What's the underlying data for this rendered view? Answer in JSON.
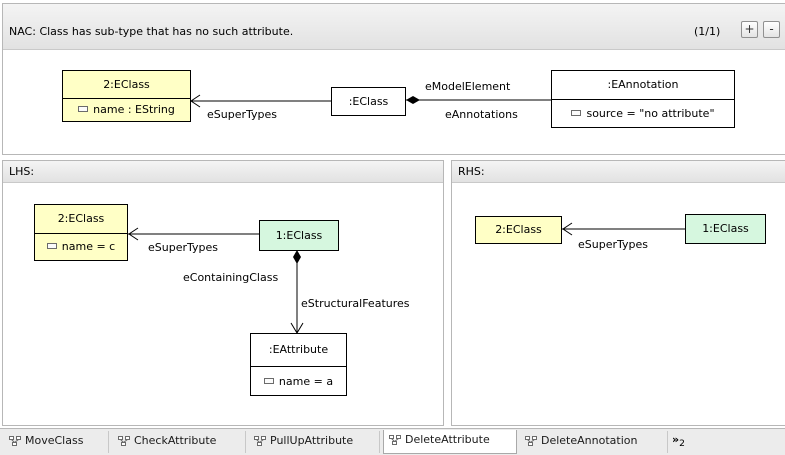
{
  "nac": {
    "title": "NAC:  Class has sub-type that has no such attribute.",
    "counter": "(1/1)",
    "add_label": "+",
    "remove_label": "-",
    "nodes": {
      "eclass2": {
        "name": "2:EClass",
        "attr": "name : EString"
      },
      "eclass": {
        "name": ":EClass"
      },
      "eannotation": {
        "name": ":EAnnotation",
        "attr": "source = \"no attribute\""
      }
    },
    "edges": {
      "supertypes": "eSuperTypes",
      "model_element": "eModelElement",
      "annotations": "eAnnotations"
    }
  },
  "lhs": {
    "title": "LHS:",
    "nodes": {
      "eclass2": {
        "name": "2:EClass",
        "attr": "name = c"
      },
      "eclass1": {
        "name": "1:EClass"
      },
      "eattribute": {
        "name": ":EAttribute",
        "attr": "name = a"
      }
    },
    "edges": {
      "supertypes": "eSuperTypes",
      "containing_class": "eContainingClass",
      "structural_features": "eStructuralFeatures"
    }
  },
  "rhs": {
    "title": "RHS:",
    "nodes": {
      "eclass2": {
        "name": "2:EClass"
      },
      "eclass1": {
        "name": "1:EClass"
      }
    },
    "edges": {
      "supertypes": "eSuperTypes"
    }
  },
  "tabs": [
    {
      "label": "MoveClass",
      "icon": "rule-icon"
    },
    {
      "label": "CheckAttribute",
      "icon": "rule-icon"
    },
    {
      "label": "PullUpAttribute",
      "icon": "rule-icon"
    },
    {
      "label": "DeleteAttribute",
      "icon": "rule-icon",
      "active": true
    },
    {
      "label": "DeleteAnnotation",
      "icon": "rule-icon"
    }
  ],
  "more_tabs": {
    "symbol": "»",
    "count": "2"
  },
  "colors": {
    "class_yellow": "#ffffc6",
    "class_green": "#d6f7df"
  }
}
